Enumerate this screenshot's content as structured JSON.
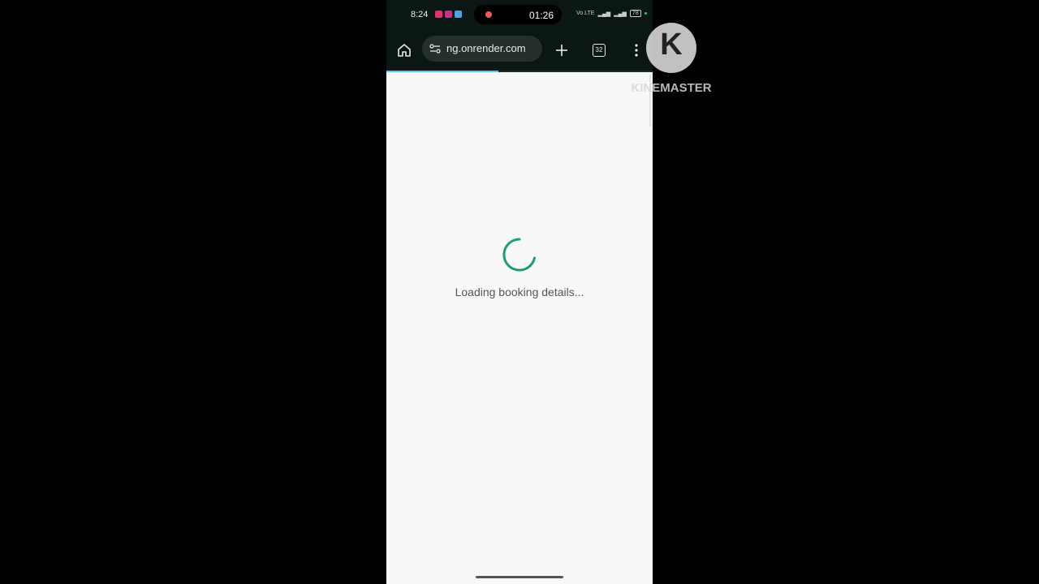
{
  "status_bar": {
    "time": "8:24",
    "recording_time": "01:26",
    "signal_text": "Vo LTE",
    "battery": "78",
    "app_icon_colors": [
      "#e1306c",
      "#c13584",
      "#4fa3e0"
    ],
    "recording_dot_color": "#f05a5a"
  },
  "browser": {
    "url_display": "ng.onrender.com",
    "tab_count": "32",
    "load_progress": 0.42,
    "icons": [
      "home-icon",
      "tune-icon",
      "plus-icon",
      "tabs-icon",
      "more-vert-icon"
    ]
  },
  "page": {
    "loading_text": "Loading booking details...",
    "spinner_color": "#1f9d6e"
  },
  "watermark": {
    "letter": "K",
    "brand": "KINEMASTER"
  }
}
